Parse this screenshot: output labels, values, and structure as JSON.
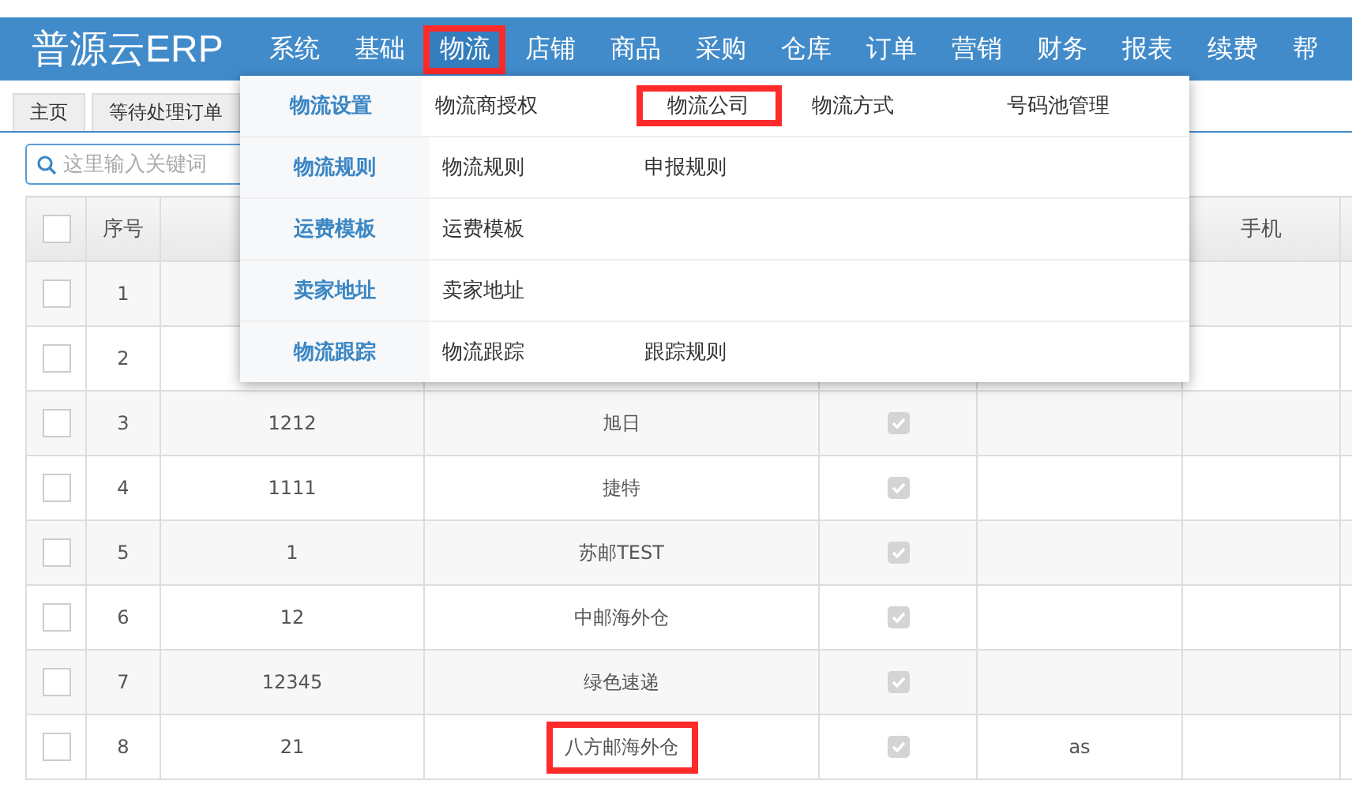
{
  "app": {
    "logo": "普源云ERP"
  },
  "nav": [
    {
      "label": "系统",
      "selected": false,
      "highlighted": false
    },
    {
      "label": "基础",
      "selected": false,
      "highlighted": false
    },
    {
      "label": "物流",
      "selected": true,
      "highlighted": true
    },
    {
      "label": "店铺",
      "selected": false,
      "highlighted": false
    },
    {
      "label": "商品",
      "selected": false,
      "highlighted": false
    },
    {
      "label": "采购",
      "selected": false,
      "highlighted": false
    },
    {
      "label": "仓库",
      "selected": false,
      "highlighted": false
    },
    {
      "label": "订单",
      "selected": false,
      "highlighted": false
    },
    {
      "label": "营销",
      "selected": false,
      "highlighted": false
    },
    {
      "label": "财务",
      "selected": false,
      "highlighted": false
    },
    {
      "label": "报表",
      "selected": false,
      "highlighted": false
    },
    {
      "label": "续费",
      "selected": false,
      "highlighted": false
    },
    {
      "label": "帮",
      "selected": false,
      "highlighted": false
    }
  ],
  "page_tabs": [
    {
      "label": "主页",
      "selected": false
    },
    {
      "label": "等待处理订单",
      "selected": false
    }
  ],
  "search": {
    "placeholder": "这里输入关键词"
  },
  "mega_menu": [
    {
      "group": "物流设置",
      "items": [
        {
          "label": "物流商授权",
          "highlighted": false
        },
        {
          "label": "物流公司",
          "highlighted": true
        },
        {
          "label": "物流方式",
          "highlighted": false
        },
        {
          "label": "号码池管理",
          "highlighted": false
        }
      ]
    },
    {
      "group": "物流规则",
      "items": [
        {
          "label": "物流规则",
          "highlighted": false
        },
        {
          "label": "申报规则",
          "highlighted": false
        }
      ]
    },
    {
      "group": "运费模板",
      "items": [
        {
          "label": "运费模板",
          "highlighted": false
        }
      ]
    },
    {
      "group": "卖家地址",
      "items": [
        {
          "label": "卖家地址",
          "highlighted": false
        }
      ]
    },
    {
      "group": "物流跟踪",
      "items": [
        {
          "label": "物流跟踪",
          "highlighted": false
        },
        {
          "label": "跟踪规则",
          "highlighted": false
        }
      ]
    }
  ],
  "table": {
    "select_all_checked": false,
    "columns": [
      "序号",
      "手机"
    ],
    "rows": [
      {
        "checked": false,
        "index": "1"
      },
      {
        "checked": false,
        "index": "2"
      },
      {
        "checked": false,
        "index": "3",
        "code": "1212",
        "name": "旭日",
        "enabled": true,
        "highlighted": false
      },
      {
        "checked": false,
        "index": "4",
        "code": "1111",
        "name": "捷特",
        "enabled": true,
        "highlighted": false
      },
      {
        "checked": false,
        "index": "5",
        "code": "1",
        "name": "苏邮TEST",
        "enabled": true,
        "highlighted": false
      },
      {
        "checked": false,
        "index": "6",
        "code": "12",
        "name": "中邮海外仓",
        "enabled": true,
        "highlighted": false
      },
      {
        "checked": false,
        "index": "7",
        "code": "12345",
        "name": "绿色速递",
        "enabled": true,
        "highlighted": false
      },
      {
        "checked": false,
        "index": "8",
        "code": "21",
        "name": "八方邮海外仓",
        "enabled": true,
        "column_6": "as",
        "highlighted": true
      }
    ]
  }
}
